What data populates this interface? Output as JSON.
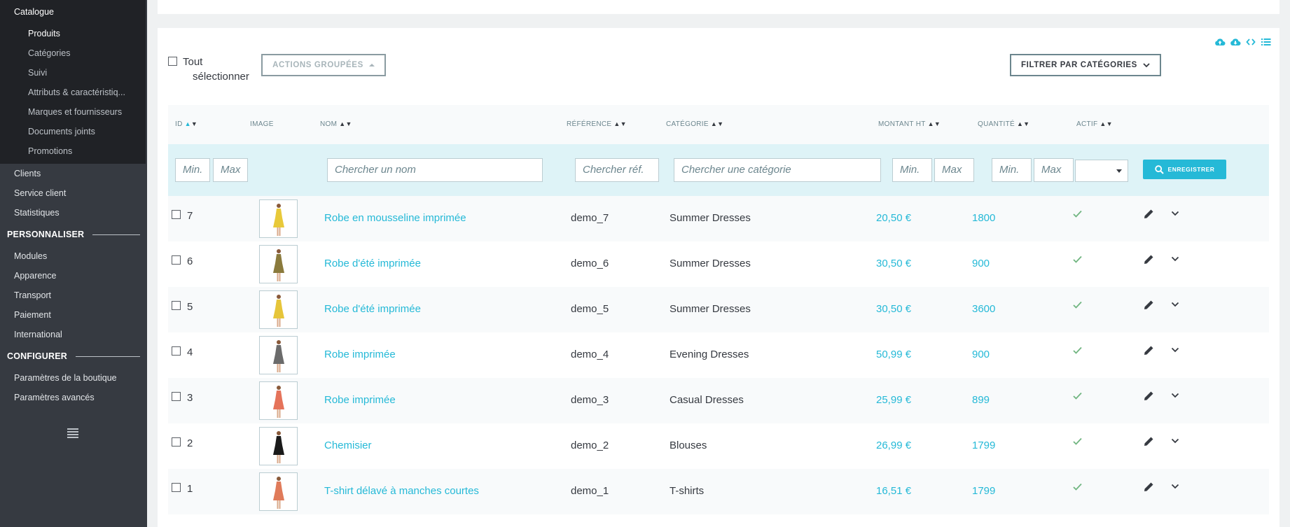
{
  "sidebar": {
    "catalogue": "Catalogue",
    "catalogue_items": [
      "Produits",
      "Catégories",
      "Suivi",
      "Attributs & caractéristiq...",
      "Marques et fournisseurs",
      "Documents joints",
      "Promotions"
    ],
    "items_after": [
      "Clients",
      "Service client",
      "Statistiques"
    ],
    "section_personnaliser": "PERSONNALISER",
    "personnaliser_items": [
      "Modules",
      "Apparence",
      "Transport",
      "Paiement",
      "International"
    ],
    "section_configurer": "CONFIGURER",
    "configurer_items": [
      "Paramètres de la boutique",
      "Paramètres avancés"
    ]
  },
  "toolbar": {
    "select_all_line1": "Tout",
    "select_all_line2": "sélectionner",
    "bulk_actions": "ACTIONS GROUPÉES",
    "filter_categories": "FILTRER PAR CATÉGORIES",
    "icons": [
      "cloud-upload-icon",
      "cloud-download-icon",
      "code-icon",
      "list-icon"
    ]
  },
  "table": {
    "headers": {
      "id": "ID",
      "image": "IMAGE",
      "name": "NOM",
      "reference": "RÉFÉRENCE",
      "category": "CATÉGORIE",
      "price": "MONTANT HT",
      "quantity": "QUANTITÉ",
      "active": "ACTIF"
    },
    "filters": {
      "id_min": "Min.",
      "id_max": "Max",
      "name": "Chercher un nom",
      "reference": "Chercher réf.",
      "category": "Chercher une catégorie",
      "price_min": "Min.",
      "price_max": "Max",
      "qty_min": "Min.",
      "qty_max": "Max",
      "search_button": "ENREGISTRER"
    },
    "rows": [
      {
        "id": "7",
        "name": "Robe en mousseline imprimée",
        "ref": "demo_7",
        "category": "Summer Dresses",
        "price": "20,50 €",
        "qty": "1800",
        "dress_color": "#e8c93a"
      },
      {
        "id": "6",
        "name": "Robe d'été imprimée",
        "ref": "demo_6",
        "category": "Summer Dresses",
        "price": "30,50 €",
        "qty": "900",
        "dress_color": "#8a7a3c"
      },
      {
        "id": "5",
        "name": "Robe d'été imprimée",
        "ref": "demo_5",
        "category": "Summer Dresses",
        "price": "30,50 €",
        "qty": "3600",
        "dress_color": "#e6c53a"
      },
      {
        "id": "4",
        "name": "Robe imprimée",
        "ref": "demo_4",
        "category": "Evening Dresses",
        "price": "50,99 €",
        "qty": "900",
        "dress_color": "#6b6b6b"
      },
      {
        "id": "3",
        "name": "Robe imprimée",
        "ref": "demo_3",
        "category": "Casual Dresses",
        "price": "25,99 €",
        "qty": "899",
        "dress_color": "#e5735a"
      },
      {
        "id": "2",
        "name": "Chemisier",
        "ref": "demo_2",
        "category": "Blouses",
        "price": "26,99 €",
        "qty": "1799",
        "dress_color": "#1a1a1a"
      },
      {
        "id": "1",
        "name": "T-shirt délavé à manches courtes",
        "ref": "demo_1",
        "category": "T-shirts",
        "price": "16,51 €",
        "qty": "1799",
        "dress_color": "#e07b5a"
      }
    ]
  }
}
